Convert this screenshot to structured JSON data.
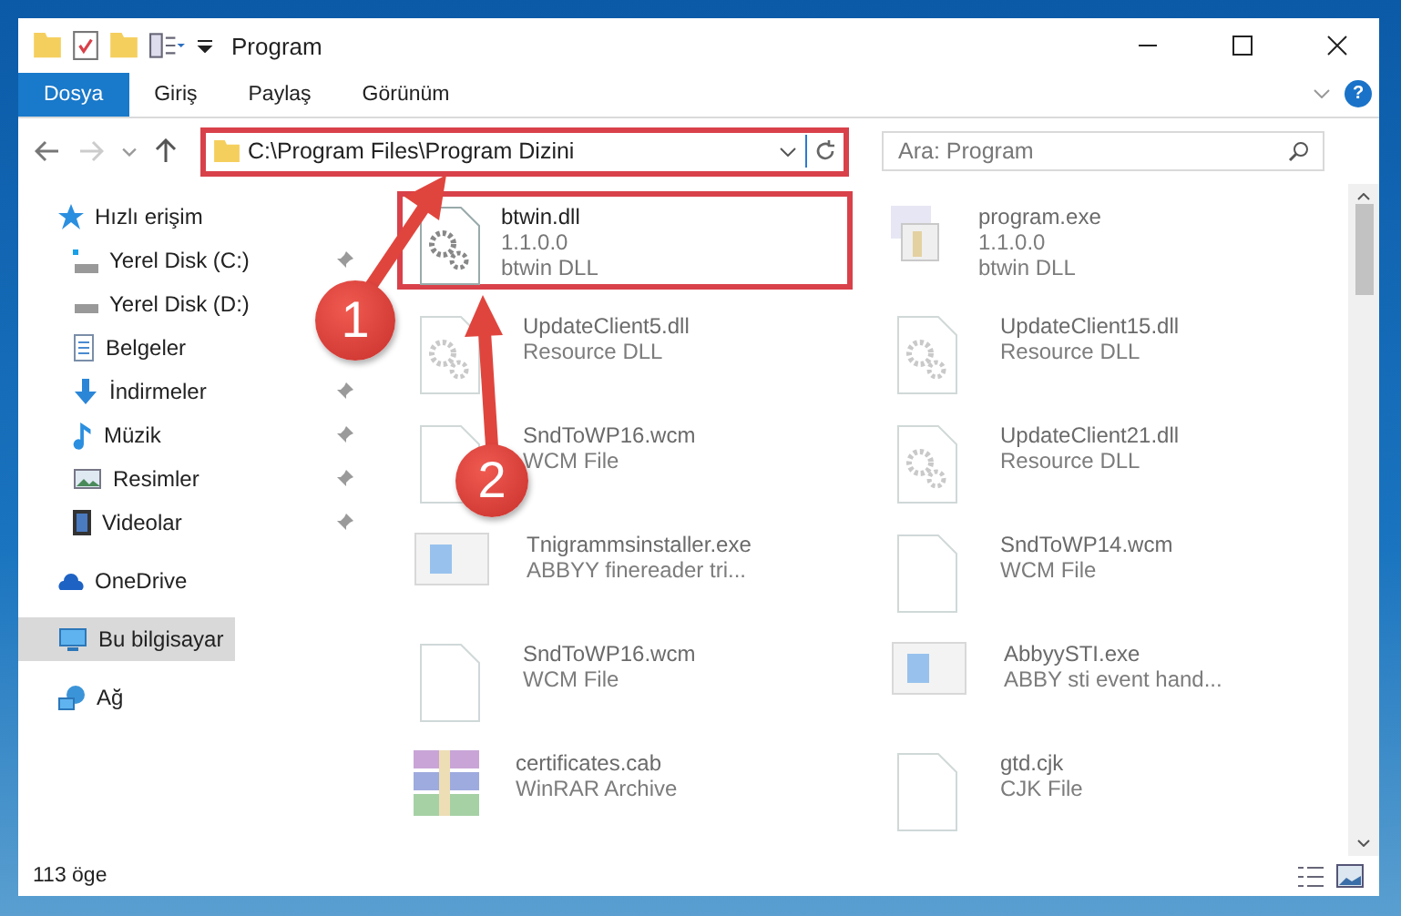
{
  "window": {
    "title": "Program"
  },
  "ribbon": {
    "tabs": [
      {
        "label": "Dosya",
        "selected": true
      },
      {
        "label": "Giriş",
        "selected": false
      },
      {
        "label": "Paylaş",
        "selected": false
      },
      {
        "label": "Görünüm",
        "selected": false
      }
    ],
    "help": "?"
  },
  "address_bar": {
    "path": "C:\\Program Files\\Program Dizini",
    "highlighted": true
  },
  "search": {
    "placeholder": "Ara: Program"
  },
  "sidebar": {
    "items": [
      {
        "label": "Hızlı erişim",
        "kind": "star",
        "pinned": false,
        "selected": false,
        "children": [
          {
            "label": "Yerel Disk (C:)",
            "kind": "system-drive",
            "pinned": true,
            "selected": false
          },
          {
            "label": "Yerel Disk (D:)",
            "kind": "drive",
            "pinned": false,
            "selected": false
          },
          {
            "label": "Belgeler",
            "kind": "document",
            "pinned": false,
            "selected": false
          },
          {
            "label": "İndirmeler",
            "kind": "download",
            "pinned": true,
            "selected": false
          },
          {
            "label": "Müzik",
            "kind": "music",
            "pinned": true,
            "selected": false
          },
          {
            "label": "Resimler",
            "kind": "image",
            "pinned": true,
            "selected": false
          },
          {
            "label": "Videolar",
            "kind": "video",
            "pinned": true,
            "selected": false
          }
        ]
      },
      {
        "label": "OneDrive",
        "kind": "cloud",
        "pinned": false,
        "selected": false
      },
      {
        "label": "Bu bilgisayar",
        "kind": "computer",
        "pinned": false,
        "selected": true
      },
      {
        "label": "Ağ",
        "kind": "network",
        "pinned": false,
        "selected": false
      }
    ]
  },
  "files": [
    {
      "name": "btwin.dll",
      "lines": [
        "1.1.0.0",
        "btwin DLL"
      ],
      "kind": "gear",
      "highlighted": true
    },
    {
      "name": "program.exe",
      "lines": [
        "1.1.0.0",
        "btwin DLL"
      ],
      "kind": "setup",
      "highlighted": false
    },
    {
      "name": "UpdateClient5.dll",
      "lines": [
        "Resource DLL"
      ],
      "kind": "gear",
      "highlighted": false
    },
    {
      "name": "UpdateClient15.dll",
      "lines": [
        "Resource DLL"
      ],
      "kind": "gear",
      "highlighted": false
    },
    {
      "name": "SndToWP16.wcm",
      "lines": [
        "WCM File"
      ],
      "kind": "blank",
      "highlighted": false
    },
    {
      "name": "UpdateClient21.dll",
      "lines": [
        "Resource DLL"
      ],
      "kind": "gear",
      "highlighted": false
    },
    {
      "name": "Tnigrammsinstaller.exe",
      "lines": [
        "ABBYY finereader tri..."
      ],
      "kind": "app",
      "highlighted": false
    },
    {
      "name": "SndToWP14.wcm",
      "lines": [
        "WCM File"
      ],
      "kind": "blank",
      "highlighted": false
    },
    {
      "name": "SndToWP16.wcm",
      "lines": [
        "WCM File"
      ],
      "kind": "blank",
      "highlighted": false
    },
    {
      "name": "AbbyySTI.exe",
      "lines": [
        "ABBY sti event hand..."
      ],
      "kind": "app",
      "highlighted": false
    },
    {
      "name": "certificates.cab",
      "lines": [
        "WinRAR Archive"
      ],
      "kind": "archive",
      "highlighted": false
    },
    {
      "name": "gtd.cjk",
      "lines": [
        "CJK File"
      ],
      "kind": "blank",
      "highlighted": false
    }
  ],
  "status_bar": {
    "count": "113 öge"
  },
  "callouts": [
    {
      "number": "1"
    },
    {
      "number": "2"
    }
  ]
}
